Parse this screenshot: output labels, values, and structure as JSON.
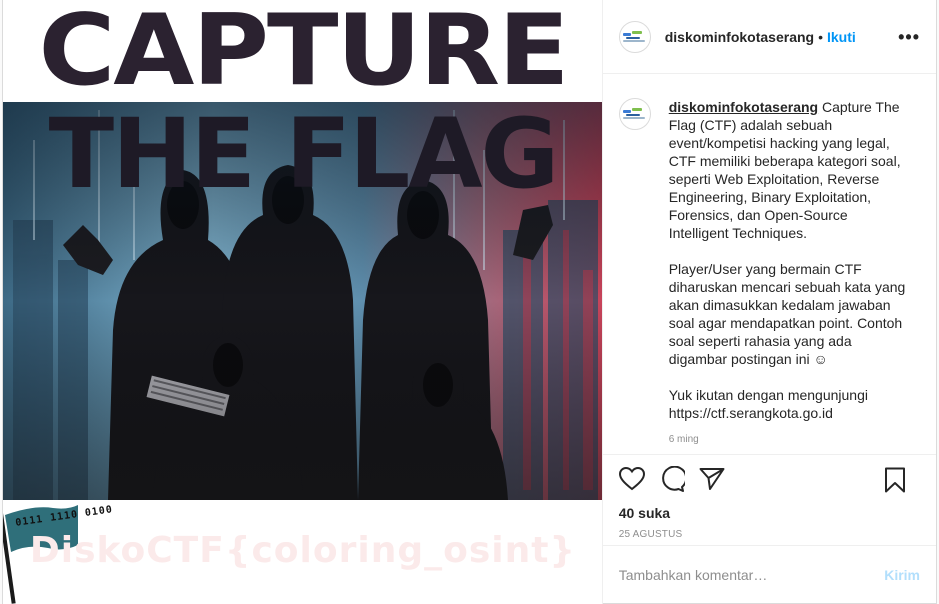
{
  "post": {
    "image": {
      "title_line1": "CAPTURE",
      "title_line2": "THE FLAG",
      "flag_text": "0111 1110 0100",
      "hidden_flag": "DiskoCTF{coloring_osint}"
    },
    "header": {
      "username": "diskominfokotaserang",
      "separator": "•",
      "follow_label": "Ikuti",
      "more_icon": "more-horizontal-icon"
    },
    "caption": {
      "username": "diskominfokotaserang",
      "paragraph1": "Capture The Flag (CTF) adalah sebuah event/kompetisi hacking yang legal, CTF memiliki beberapa kategori soal, seperti Web Exploitation, Reverse Engineering, Binary Exploitation, Forensics, dan Open-Source Intelligent Techniques.",
      "paragraph2": "Player/User yang bermain CTF diharuskan mencari sebuah kata yang akan dimasukkan kedalam jawaban soal agar mendapatkan point. Contoh soal seperti rahasia yang ada digambar postingan ini ☺",
      "paragraph3": "Yuk ikutan dengan mengunjungi\nhttps://ctf.serangkota.go.id",
      "time": "6 ming"
    },
    "actions": {
      "icons": [
        "heart-icon",
        "comment-icon",
        "share-icon",
        "bookmark-icon"
      ]
    },
    "likes": "40 suka",
    "date": "25 AGUSTUS",
    "comment_box": {
      "placeholder": "Tambahkan komentar…",
      "post_label": "Kirim"
    },
    "colors": {
      "link_blue": "#0095f6",
      "post_disabled": "#b2dffc",
      "muted": "#8e8e8e",
      "text": "#262626"
    }
  }
}
